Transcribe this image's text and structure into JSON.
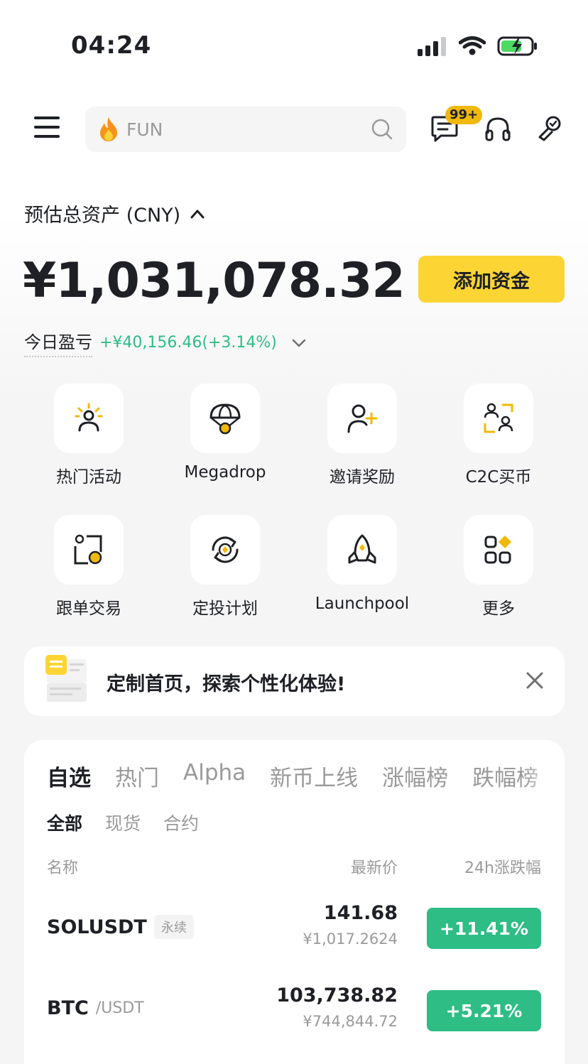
{
  "status_bar": {
    "time": "04:24"
  },
  "search": {
    "placeholder": "FUN"
  },
  "header": {
    "message_badge": "99+"
  },
  "assets": {
    "label": "预估总资产 (CNY)",
    "value": "¥1,031,078.32",
    "add_funds": "添加资金",
    "pnl_label": "今日盈亏",
    "pnl_value": "+¥40,156.46(+3.14%)"
  },
  "shortcuts": [
    {
      "label": "热门活动",
      "icon": "hot-activity-icon"
    },
    {
      "label": "Megadrop",
      "icon": "parachute-icon"
    },
    {
      "label": "邀请奖励",
      "icon": "invite-user-icon"
    },
    {
      "label": "C2C买币",
      "icon": "c2c-icon"
    },
    {
      "label": "跟单交易",
      "icon": "copy-trade-icon"
    },
    {
      "label": "定投计划",
      "icon": "recurring-buy-icon"
    },
    {
      "label": "Launchpool",
      "icon": "rocket-icon"
    },
    {
      "label": "更多",
      "icon": "more-grid-icon"
    }
  ],
  "banner": {
    "text": "定制首页，探索个性化体验!"
  },
  "market": {
    "tabs": [
      "自选",
      "热门",
      "Alpha",
      "新币上线",
      "涨幅榜",
      "跌幅榜"
    ],
    "sub_tabs": [
      "全部",
      "现货",
      "合约"
    ],
    "columns": {
      "name": "名称",
      "price": "最新价",
      "change": "24h涨跌幅"
    },
    "rows": [
      {
        "symbol": "SOLUSDT",
        "tag": "永续",
        "price": "141.68",
        "price_cny": "¥1,017.2624",
        "change": "+11.41%"
      },
      {
        "symbol": "BTC",
        "suffix": "/USDT",
        "price": "103,738.82",
        "price_cny": "¥744,844.72",
        "change": "+5.21%"
      }
    ]
  },
  "colors": {
    "brand_yellow": "#fcd535",
    "up_green": "#2ebd85",
    "text": "#1e2026",
    "muted": "#9a9a9a"
  }
}
